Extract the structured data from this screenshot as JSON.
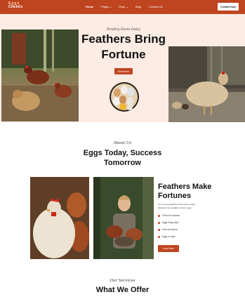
{
  "nav": {
    "logo_top": "Eggs",
    "logo": "ChickCo",
    "items": [
      "Home",
      "Pages ⌄",
      "Shop ⌄",
      "Blog",
      "Contact Us"
    ],
    "cta": "Contact Now"
  },
  "hero": {
    "tagline": "Poultry Farm Daily",
    "title_line1": "Feathers Bring",
    "title_line2": "Fortune",
    "button": "Read More"
  },
  "about": {
    "tagline": "About Us",
    "title_line1": "Eggs Today, Success",
    "title_line2": "Tomorrow"
  },
  "feature": {
    "title_line1": "Feathers Make",
    "title_line2": "Fortunes",
    "text_line1": "It is a long established fact that a reader",
    "text_line2": "distracted by readable content page.",
    "list": [
      "Chick for success",
      "Eggs bring hope",
      "Farm the future",
      "Eggs of hope"
    ],
    "button": "Learn More"
  },
  "services": {
    "tagline": "Our Services",
    "title": "What We Offer"
  },
  "colors": {
    "accent": "#bf4520",
    "hero_bg": "#fdece4"
  }
}
